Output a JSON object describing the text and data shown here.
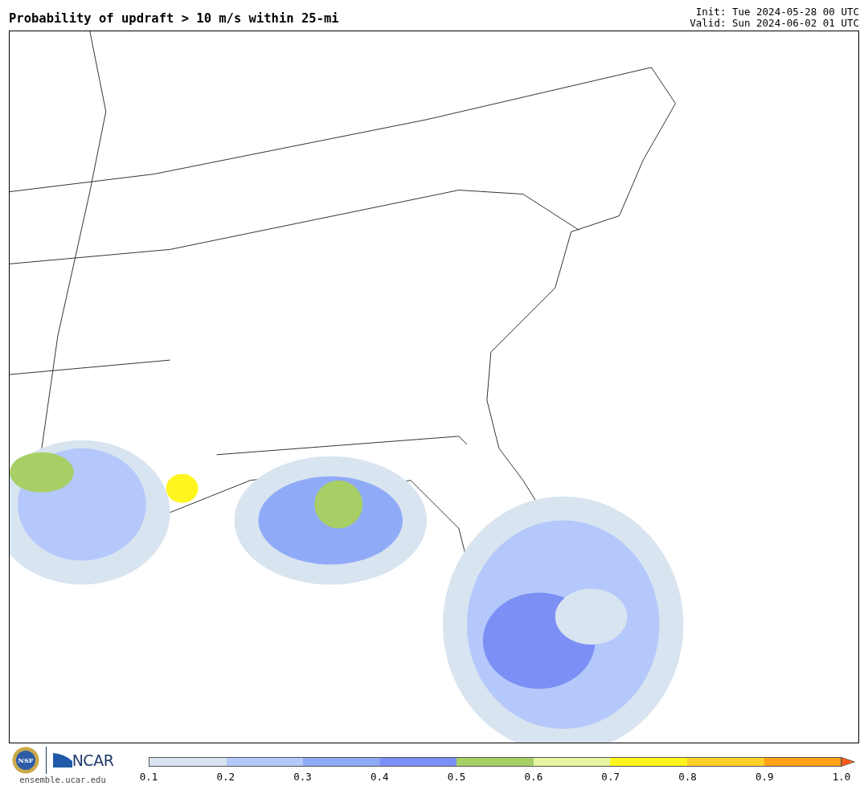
{
  "header": {
    "title": "Probability of updraft > 10 m/s within 25-mi",
    "init": "Init: Tue 2024-05-28 00 UTC",
    "valid": "Valid: Sun 2024-06-02 01 UTC"
  },
  "footer": {
    "logos": [
      {
        "kind": "seal",
        "text": "NSF"
      },
      {
        "kind": "wordmark",
        "text": "NCAR"
      }
    ],
    "url": "ensemble.ucar.edu"
  },
  "colorbar": {
    "segments": [
      {
        "color": "#d8e4f0"
      },
      {
        "color": "#b4c8fb"
      },
      {
        "color": "#8fabf8"
      },
      {
        "color": "#7b8ff4"
      },
      {
        "color": "#a8ce66"
      },
      {
        "color": "#e6f5a2"
      },
      {
        "color": "#fff51e"
      },
      {
        "color": "#ffd128"
      },
      {
        "color": "#ffa214"
      }
    ],
    "extension": {
      "kind": "arrow",
      "color": "#ff5a14"
    },
    "ticks": [
      "0.1",
      "0.2",
      "0.3",
      "0.4",
      "0.5",
      "0.6",
      "0.7",
      "0.8",
      "0.9",
      "1.0"
    ]
  }
}
